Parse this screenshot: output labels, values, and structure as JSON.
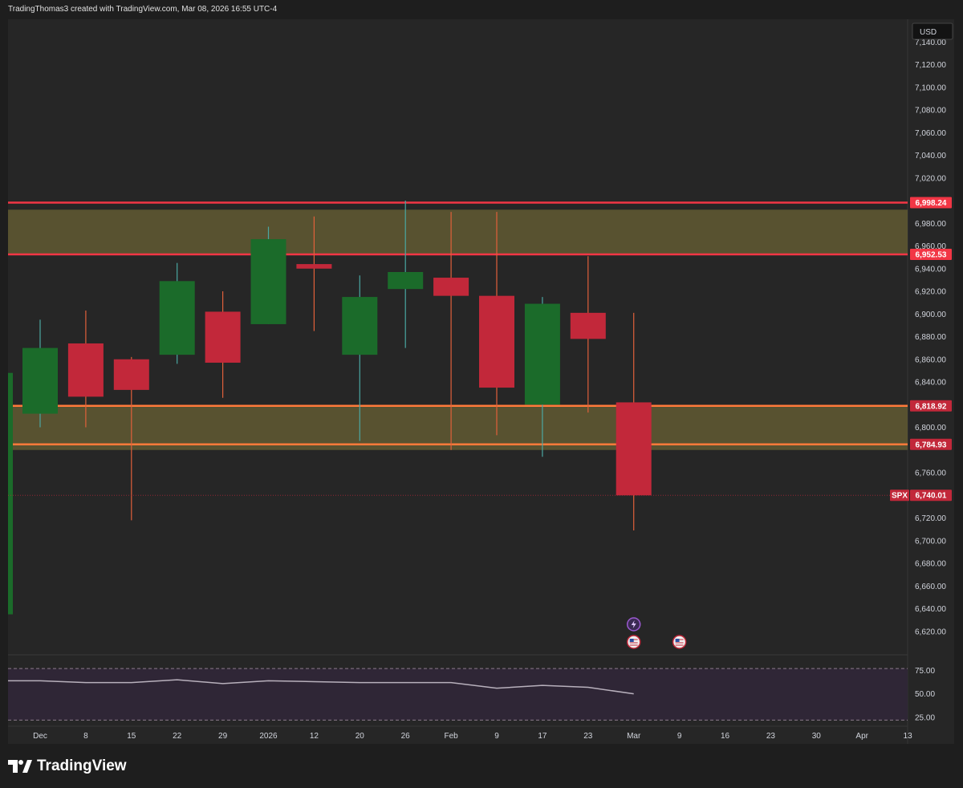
{
  "header": {
    "attribution": "TradingThomas3 created with TradingView.com, Mar 08, 2026 16:55 UTC-4"
  },
  "currency": "USD",
  "brand": {
    "logo_text": "TradingView",
    "logo_icon": "tradingview-logo-icon"
  },
  "colors": {
    "up": "#1b6b2a",
    "up_wick": "#4aa7a2",
    "down": "#c2283a",
    "down_wick": "#e0603a",
    "resistance_line": "#f23645",
    "support_line": "#ff7a3a",
    "zone_fill": "#5b5430",
    "oscillator_bg": "#2f2636"
  },
  "chart_data": {
    "type": "candlestick",
    "symbol": "SPX",
    "ylim": [
      6600,
      7160
    ],
    "y_ticks": [
      "7,140.00",
      "7,120.00",
      "7,100.00",
      "7,080.00",
      "7,060.00",
      "7,040.00",
      "7,020.00",
      "6,980.00",
      "6,960.00",
      "6,940.00",
      "6,920.00",
      "6,900.00",
      "6,880.00",
      "6,860.00",
      "6,840.00",
      "6,800.00",
      "6,760.00",
      "6,720.00",
      "6,700.00",
      "6,680.00",
      "6,660.00",
      "6,640.00",
      "6,620.00"
    ],
    "x_ticks": [
      "Dec",
      "8",
      "15",
      "22",
      "29",
      "2026",
      "12",
      "20",
      "26",
      "Feb",
      "9",
      "17",
      "23",
      "Mar",
      "9",
      "16",
      "23",
      "30",
      "Apr",
      "13"
    ],
    "candles": [
      {
        "x": "Dec",
        "open": 6812,
        "high": 6895,
        "low": 6800,
        "close": 6870
      },
      {
        "x": "8",
        "open": 6874,
        "high": 6903,
        "low": 6800,
        "close": 6827
      },
      {
        "x": "15",
        "open": 6860,
        "high": 6862,
        "low": 6718,
        "close": 6833
      },
      {
        "x": "22",
        "open": 6864,
        "high": 6945,
        "low": 6856,
        "close": 6929
      },
      {
        "x": "29",
        "open": 6902,
        "high": 6920,
        "low": 6826,
        "close": 6857
      },
      {
        "x": "2026",
        "open": 6891,
        "high": 6977,
        "low": 6891,
        "close": 6966
      },
      {
        "x": "12",
        "open": 6944,
        "high": 6986,
        "low": 6885,
        "close": 6940
      },
      {
        "x": "20",
        "open": 6864,
        "high": 6934,
        "low": 6788,
        "close": 6915
      },
      {
        "x": "26",
        "open": 6922,
        "high": 7000,
        "low": 6870,
        "close": 6937
      },
      {
        "x": "Feb",
        "open": 6932,
        "high": 6990,
        "low": 6780,
        "close": 6916
      },
      {
        "x": "9",
        "open": 6916,
        "high": 6990,
        "low": 6793,
        "close": 6835
      },
      {
        "x": "17",
        "open": 6820,
        "high": 6915,
        "low": 6774,
        "close": 6909
      },
      {
        "x": "23",
        "open": 6901,
        "high": 6951,
        "low": 6813,
        "close": 6878
      },
      {
        "x": "Mar",
        "open": 6822,
        "high": 6901,
        "low": 6709,
        "close": 6740
      }
    ],
    "levels": [
      {
        "label": "6,998.24",
        "value": 6998.24,
        "kind": "resistance"
      },
      {
        "label": "6,952.53",
        "value": 6952.53,
        "kind": "resistance"
      },
      {
        "label": "6,818.92",
        "value": 6818.92,
        "kind": "support"
      },
      {
        "label": "6,784.93",
        "value": 6784.93,
        "kind": "support"
      }
    ],
    "zones": [
      {
        "from": 6952.53,
        "to": 6992
      },
      {
        "from": 6780,
        "to": 6818.92
      }
    ],
    "last_price": {
      "symbol": "SPX",
      "label": "6,740.01",
      "value": 6740.01
    },
    "oscillator": {
      "ylim": [
        18,
        90
      ],
      "y_ticks": [
        "75.00",
        "50.00",
        "25.00"
      ],
      "bands": [
        77,
        22
      ],
      "values": [
        {
          "x": "Dec",
          "y": 64
        },
        {
          "x": "8",
          "y": 62
        },
        {
          "x": "15",
          "y": 62
        },
        {
          "x": "22",
          "y": 65
        },
        {
          "x": "29",
          "y": 61
        },
        {
          "x": "2026",
          "y": 64
        },
        {
          "x": "12",
          "y": 63
        },
        {
          "x": "20",
          "y": 62
        },
        {
          "x": "26",
          "y": 62
        },
        {
          "x": "Feb",
          "y": 62
        },
        {
          "x": "9",
          "y": 56
        },
        {
          "x": "17",
          "y": 59
        },
        {
          "x": "23",
          "y": 57
        },
        {
          "x": "Mar",
          "y": 50
        }
      ]
    },
    "events": [
      {
        "x": "Mar",
        "icon": "lightning-icon"
      },
      {
        "x": "Mar",
        "icon": "us-flag-icon"
      },
      {
        "x": "9",
        "icon": "us-flag-icon"
      }
    ]
  }
}
